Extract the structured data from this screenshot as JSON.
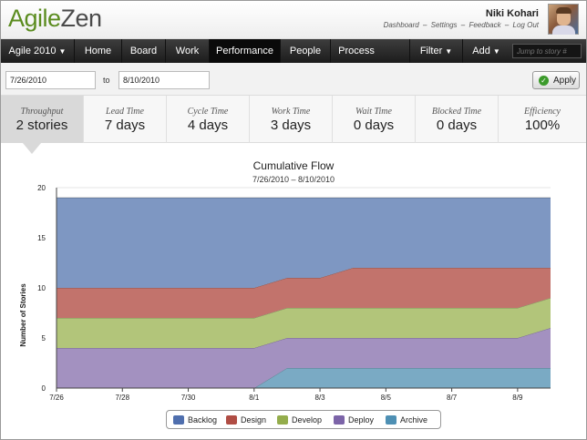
{
  "header": {
    "logo_part1": "Agile",
    "logo_part2": "Zen",
    "user_name": "Niki Kohari",
    "links": [
      "Dashboard",
      "Settings",
      "Feedback",
      "Log Out"
    ],
    "link_separator": "–"
  },
  "nav": {
    "project": "Agile 2010",
    "items": [
      "Home",
      "Board",
      "Work",
      "Performance",
      "People",
      "Process"
    ],
    "active": "Performance",
    "filter": "Filter",
    "add": "Add",
    "jump_placeholder": "Jump to story #",
    "caret": "▼"
  },
  "daterange": {
    "from": "7/26/2010",
    "to_label": "to",
    "to": "8/10/2010",
    "apply_label": "Apply",
    "apply_icon": "check-icon"
  },
  "metrics": [
    {
      "label": "Throughput",
      "value": "2 stories"
    },
    {
      "label": "Lead Time",
      "value": "7 days"
    },
    {
      "label": "Cycle Time",
      "value": "4 days"
    },
    {
      "label": "Work Time",
      "value": "3 days"
    },
    {
      "label": "Wait Time",
      "value": "0 days"
    },
    {
      "label": "Blocked Time",
      "value": "0 days"
    },
    {
      "label": "Efficiency",
      "value": "100%"
    }
  ],
  "chart_data": {
    "type": "area",
    "stacked": true,
    "title": "Cumulative Flow",
    "subtitle": "7/26/2010 – 8/10/2010",
    "xlabel": "",
    "ylabel": "Number of Stories",
    "ylim": [
      0,
      20
    ],
    "yticks": [
      0,
      5,
      10,
      15,
      20
    ],
    "x": [
      "7/26",
      "7/27",
      "7/28",
      "7/29",
      "7/30",
      "7/31",
      "8/1",
      "8/2",
      "8/3",
      "8/4",
      "8/5",
      "8/6",
      "8/7",
      "8/8",
      "8/9",
      "8/10"
    ],
    "xtick_labels": [
      "7/26",
      "7/28",
      "7/30",
      "8/1",
      "8/3",
      "8/5",
      "8/7",
      "8/9"
    ],
    "series": [
      {
        "name": "Archive",
        "color": "#7aaac4",
        "values": [
          0,
          0,
          0,
          0,
          0,
          0,
          0,
          2,
          2,
          2,
          2,
          2,
          2,
          2,
          2,
          2
        ]
      },
      {
        "name": "Deploy",
        "color": "#a391c0",
        "values": [
          4,
          4,
          4,
          4,
          4,
          4,
          4,
          3,
          3,
          3,
          3,
          3,
          3,
          3,
          3,
          4
        ]
      },
      {
        "name": "Develop",
        "color": "#b2c57a",
        "values": [
          3,
          3,
          3,
          3,
          3,
          3,
          3,
          3,
          3,
          3,
          3,
          3,
          3,
          3,
          3,
          3
        ]
      },
      {
        "name": "Design",
        "color": "#c2736c",
        "values": [
          3,
          3,
          3,
          3,
          3,
          3,
          3,
          3,
          3,
          4,
          4,
          4,
          4,
          4,
          4,
          3
        ]
      },
      {
        "name": "Backlog",
        "color": "#7e97c2",
        "values": [
          9,
          9,
          9,
          9,
          9,
          9,
          9,
          8,
          8,
          7,
          7,
          7,
          7,
          7,
          7,
          7
        ]
      }
    ],
    "legend": [
      "Backlog",
      "Design",
      "Develop",
      "Deploy",
      "Archive"
    ],
    "legend_position": "bottom-center",
    "grid": true
  }
}
